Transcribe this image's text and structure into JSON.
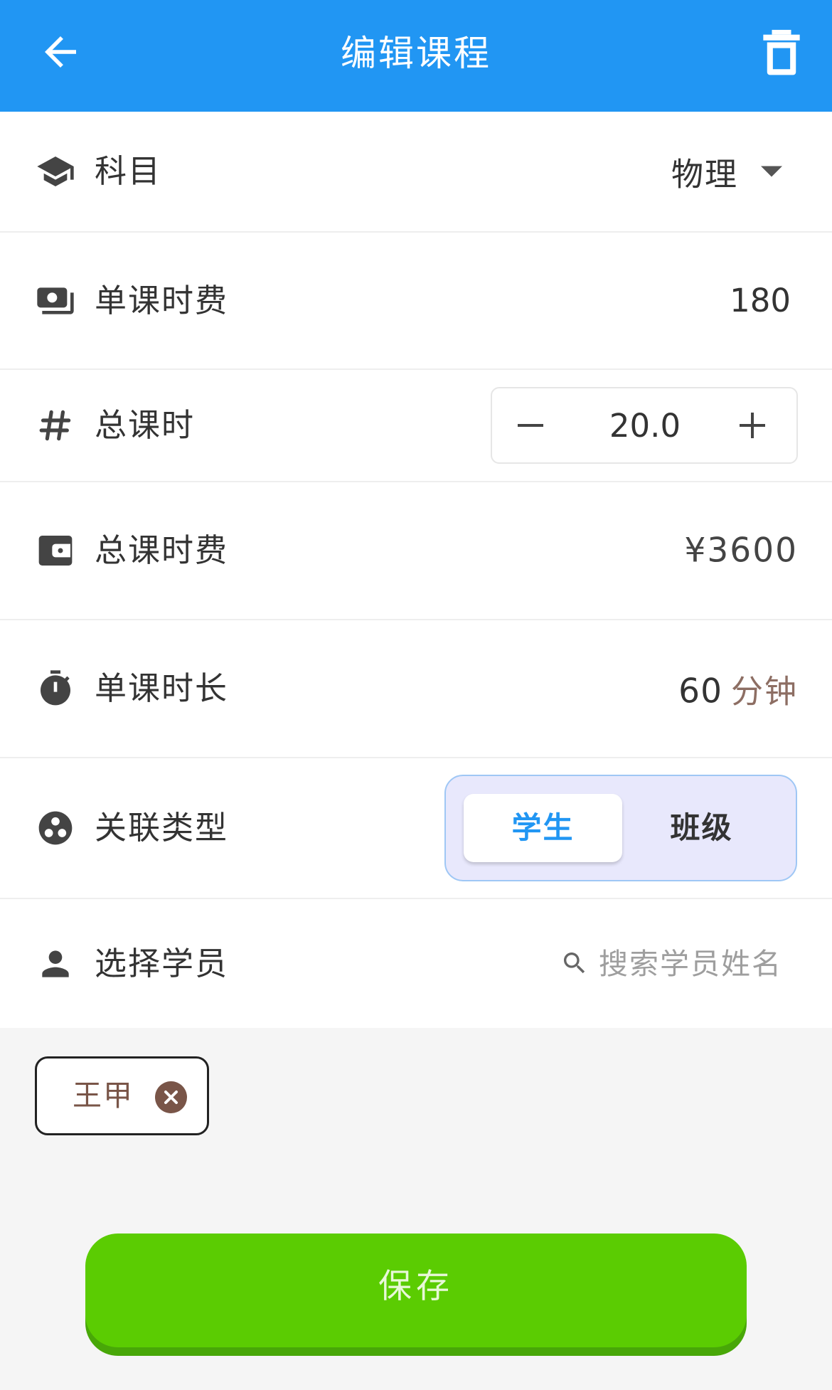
{
  "appbar": {
    "title": "编辑课程",
    "back_icon": "arrow-left-icon",
    "delete_icon": "trash-icon",
    "color": "#2196f3"
  },
  "form": {
    "subject": {
      "label": "科目",
      "value": "物理",
      "icon": "school-cap-icon"
    },
    "rate": {
      "label": "单课时费",
      "value": "180",
      "icon": "payments-icon"
    },
    "total_hours": {
      "label": "总课时",
      "value": "20.0",
      "icon": "hash-icon"
    },
    "total_fee": {
      "label": "总课时费",
      "value": "¥3600",
      "icon": "wallet-icon"
    },
    "duration": {
      "label": "单课时长",
      "value": "60",
      "unit": "分钟",
      "icon": "timer-icon"
    },
    "link_type": {
      "label": "关联类型",
      "icon": "group-work-icon",
      "options": [
        "学生",
        "班级"
      ],
      "selected": "学生"
    },
    "student": {
      "label": "选择学员",
      "placeholder": "搜索学员姓名",
      "icon": "person-icon"
    }
  },
  "selected_students": [
    "王甲"
  ],
  "save_label": "保存",
  "colors": {
    "accent": "#2196f3",
    "save": "#5bcc02",
    "chip": "#795548",
    "unit": "#8d6e63"
  }
}
